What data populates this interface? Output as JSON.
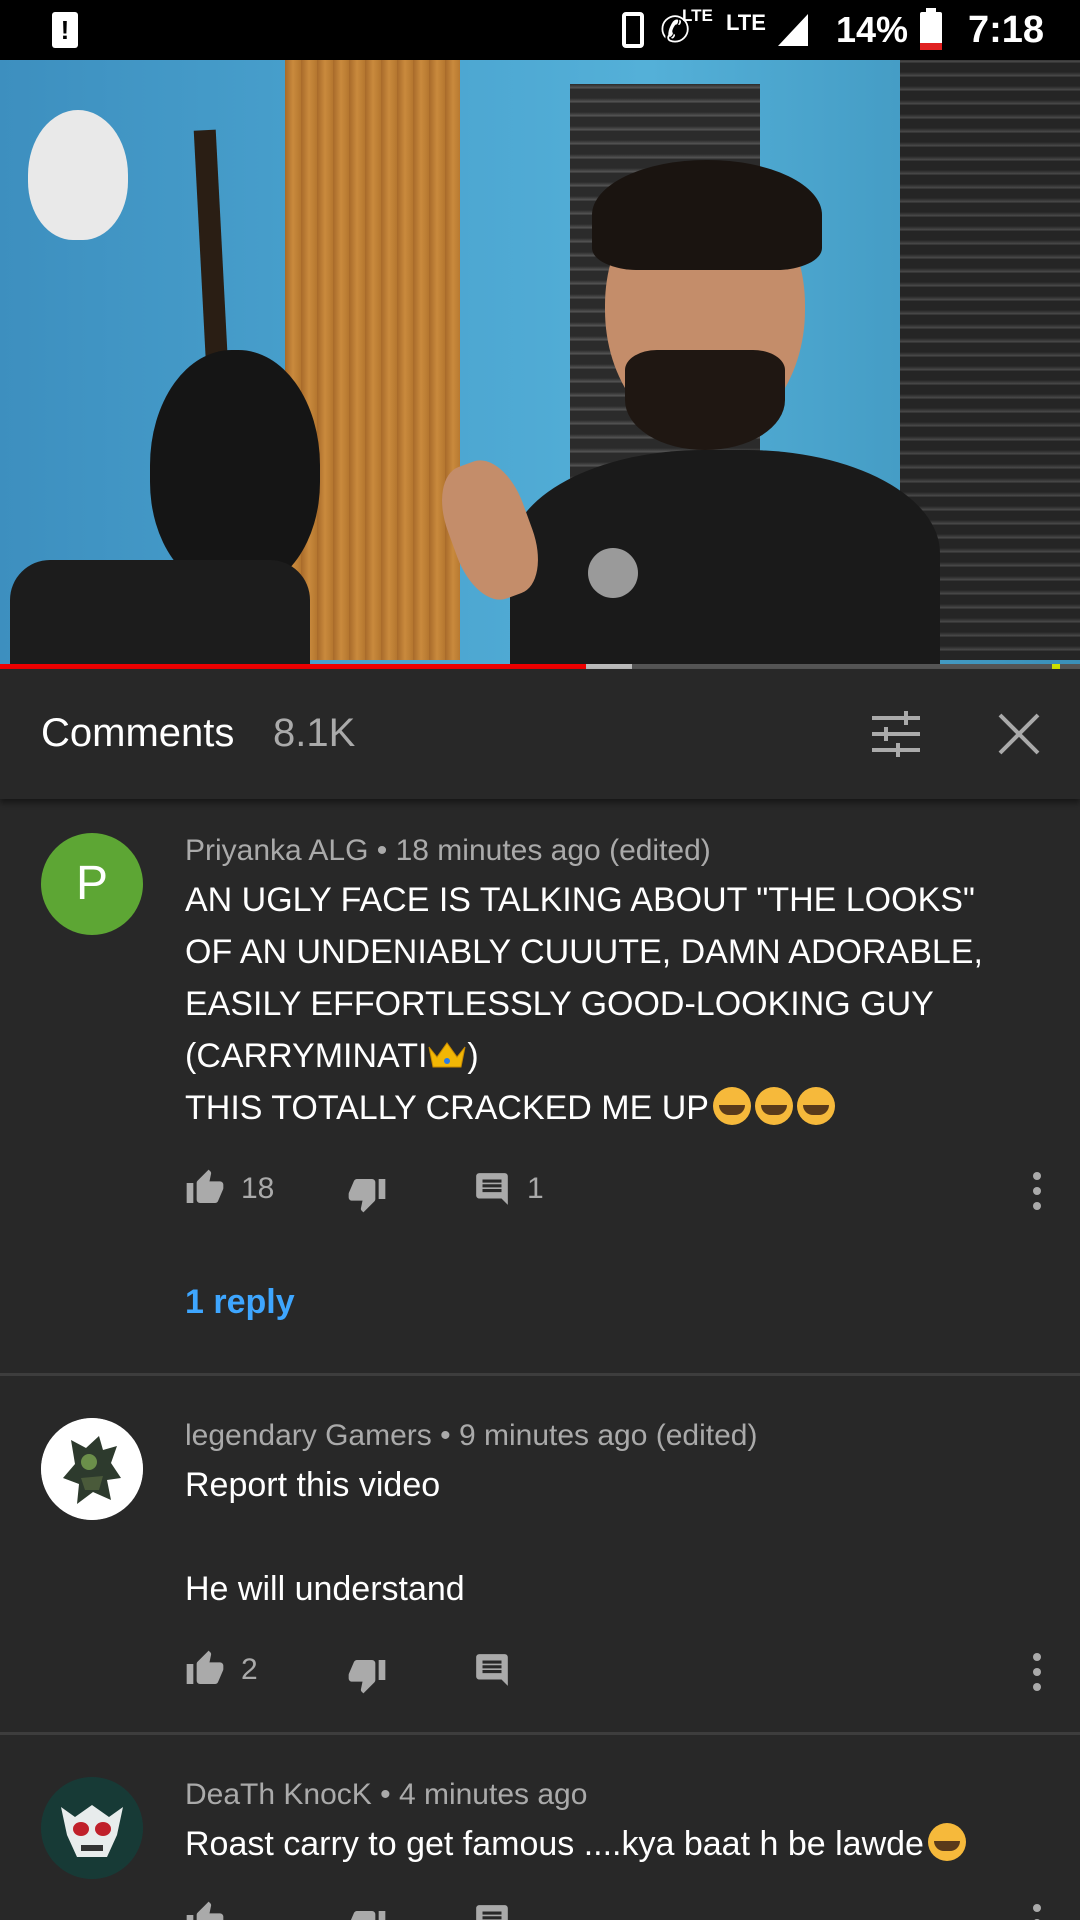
{
  "status_bar": {
    "network_1": "LTE",
    "network_2": "LTE",
    "battery": "14%",
    "time": "7:18"
  },
  "video": {
    "progress_played": 0.543,
    "progress_buffered": 0.585
  },
  "comments_header": {
    "title": "Comments",
    "count": "8.1K",
    "filter_icon": "sliders-icon",
    "close_icon": "close-icon"
  },
  "comments": [
    {
      "avatar_letter": "P",
      "avatar_color": "#5da634",
      "author": "Priyanka ALG",
      "meta": "Priyanka ALG • 18 minutes ago (edited)",
      "lines": [
        "AN UGLY FACE IS TALKING ABOUT \"THE LOOKS\"",
        "OF AN UNDENIABLY CUUUTE, DAMN ADORABLE,",
        "EASILY EFFORTLESSLY GOOD-LOOKING GUY",
        "(CARRYMINATI",
        ")",
        "THIS TOTALLY CRACKED ME UP"
      ],
      "likes": "18",
      "reply_count": "1",
      "replies_link": "1 reply"
    },
    {
      "author": "legendary Gamers",
      "meta": "legendary Gamers • 9 minutes ago (edited)",
      "lines": [
        "Report this video",
        "",
        "He will understand"
      ],
      "likes": "2"
    },
    {
      "author": "DeaTh KnocK",
      "meta": "DeaTh KnocK • 4 minutes ago",
      "lines": [
        "Roast carry to get famous ....kya baat h be lawde"
      ]
    }
  ]
}
